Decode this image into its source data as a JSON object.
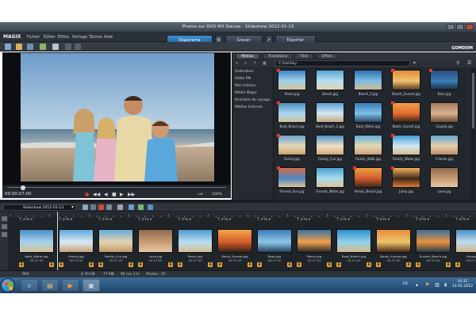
{
  "window": {
    "title": "Photos sur DVD MX Deluxe - Slideshow 2012-01-13"
  },
  "menu": {
    "logo": "MAGIX",
    "items": [
      "Fichier",
      "Éditer",
      "Effets",
      "Partage",
      "Tâches",
      "Aide"
    ]
  },
  "modes": [
    {
      "label": "Diaporama",
      "active": true
    },
    {
      "label": "Graver",
      "active": false
    },
    {
      "label": "Exporter",
      "active": false
    }
  ],
  "preview": {
    "timecode": "00:00:07:00",
    "zoom": "100%"
  },
  "media": {
    "tabs": [
      "Médias",
      "Transitions",
      "Titre",
      "Effets"
    ],
    "path": "C:\\Holiday",
    "brand": "GOMDOM",
    "folders": [
      "Ordinateur",
      "Vidéo PM",
      "Mes médias",
      "Média Magix",
      "Itinéraire de voyage...",
      "Médias Internet..."
    ],
    "files": [
      "Alone.jpg",
      "Beach.jpg",
      "Beach_2.jpg",
      "Beach_Sunset.jpg",
      "Blue.jpg",
      "Boat_Beach.jpg",
      "Boat_Beach_2.jpg",
      "Boat_Water.jpg",
      "Boats_Sunset.jpg",
      "Couple.jpg",
      "Family.jpg",
      "Family_Fun.jpg",
      "Family_Walk.jpg",
      "Family_Water.jpg",
      "Friends.jpg",
      "Friends_Fun.jpg",
      "Friends_Water.jpg",
      "Honey_Beach.jpg",
      "Jump.jpg",
      "Love.jpg"
    ]
  },
  "timeline": {
    "show": "Slideshow 2012-01-13",
    "slides": [
      {
        "name": "Boat_Water.jpg",
        "duration": "00:07:00"
      },
      {
        "name": "Family.jpg",
        "duration": "00:07:00"
      },
      {
        "name": "Family_Fun.jpg",
        "duration": "00:07:00"
      },
      {
        "name": "Love.jpg",
        "duration": "00:07:00"
      },
      {
        "name": "Relax.jpg",
        "duration": "00:07:00"
      },
      {
        "name": "Relax_Sunset.jpg",
        "duration": "00:07:00"
      },
      {
        "name": "Boat.jpg",
        "duration": "00:07:00"
      },
      {
        "name": "Palms.jpg",
        "duration": "00:07:00"
      },
      {
        "name": "Boat_Beach.jpg",
        "duration": "00:07:00"
      },
      {
        "name": "Boats_Sunset.jpg",
        "duration": "00:07:00"
      },
      {
        "name": "Sunset_Beach.jpg",
        "duration": "00:07:00"
      },
      {
        "name": "Honey...",
        "duration": "00:07:00"
      }
    ],
    "fx_label": "T  ↺  fx ▾"
  },
  "status": [
    "900",
    "4.70 GB",
    "77 MB",
    "95 (ca 3 h)",
    "Photos : 15"
  ],
  "taskbar": {
    "date": "13.01.2012",
    "time": "16:31",
    "lang": "DE"
  }
}
